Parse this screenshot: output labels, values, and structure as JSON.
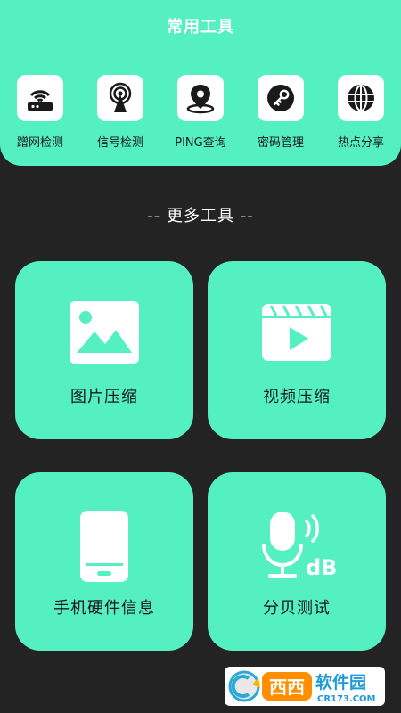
{
  "header": {
    "title": "常用工具"
  },
  "common_tools": [
    {
      "label": "蹭网检测",
      "icon": "router-icon"
    },
    {
      "label": "信号检测",
      "icon": "signal-tower-icon"
    },
    {
      "label": "PING查询",
      "icon": "location-pin-icon"
    },
    {
      "label": "密码管理",
      "icon": "key-icon"
    },
    {
      "label": "热点分享",
      "icon": "globe-icon"
    }
  ],
  "more_tools": {
    "title": "--  更多工具  --",
    "cards": [
      {
        "label": "图片压缩",
        "icon": "image-icon"
      },
      {
        "label": "视频压缩",
        "icon": "video-icon"
      },
      {
        "label": "手机硬件信息",
        "icon": "phone-icon"
      },
      {
        "label": "分贝测试",
        "icon": "microphone-db-icon"
      }
    ]
  },
  "watermark": {
    "brand": "西西",
    "name": "软件园",
    "url": "CR173.COM"
  },
  "colors": {
    "accent": "#55f0c2",
    "background": "#232323",
    "icon_dark": "#1a1a1a"
  }
}
